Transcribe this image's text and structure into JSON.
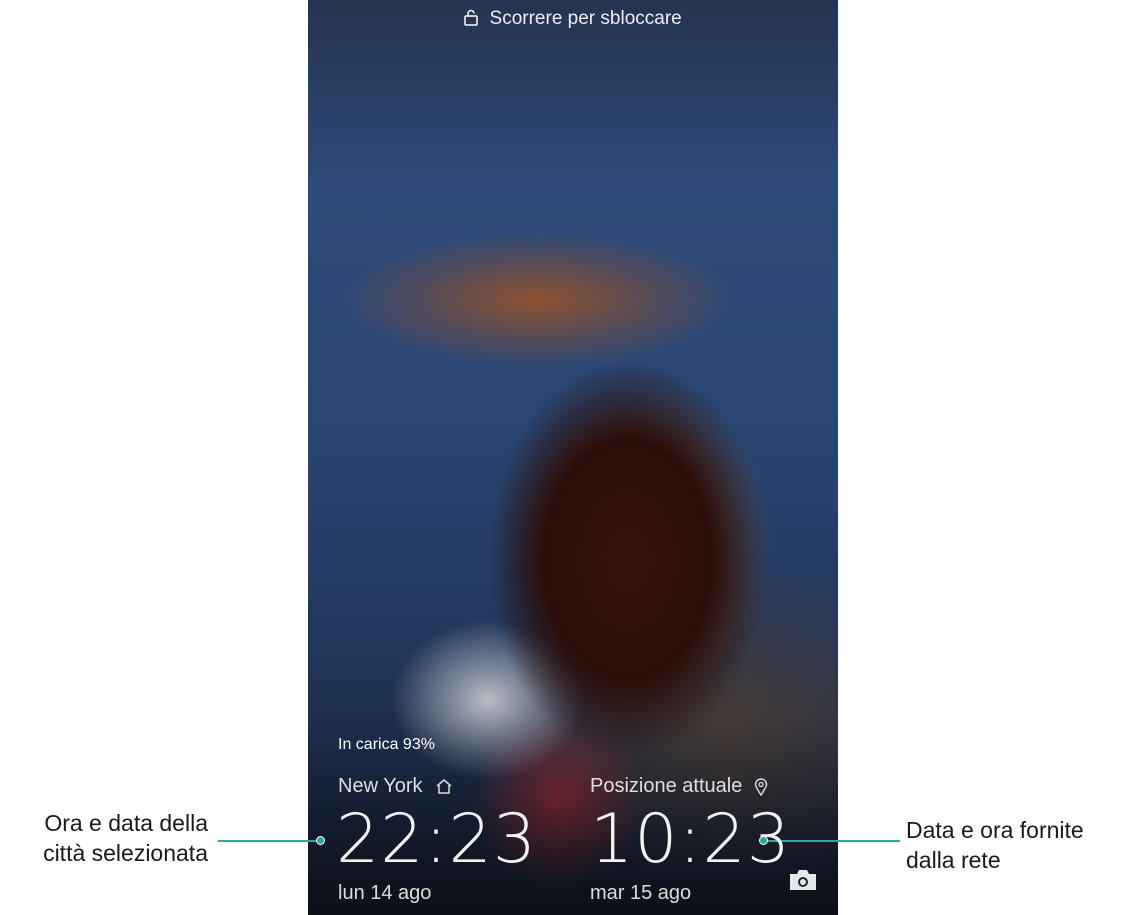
{
  "lock_screen": {
    "unlock_hint": "Scorrere per sbloccare",
    "charging": "In carica 93%",
    "home_city": {
      "name": "New York",
      "time": "22:23",
      "date": "lun 14 ago"
    },
    "current_city": {
      "name": "Posizione attuale",
      "time": "10:23",
      "date": "mar 15 ago"
    },
    "icons": [
      "lock-icon",
      "home-icon",
      "location-pin-icon",
      "camera-icon"
    ]
  },
  "annotations": {
    "left_line1": "Ora e data della",
    "left_line2": "città selezionata",
    "right_line1": "Data e ora fornite",
    "right_line2": "dalla rete",
    "accent_color": "#2aa7a3"
  }
}
